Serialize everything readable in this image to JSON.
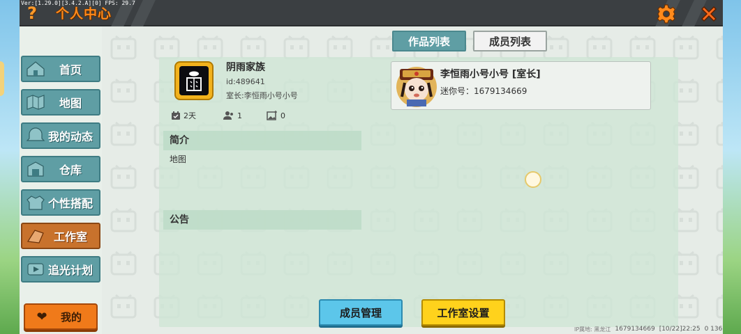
{
  "app": {
    "version": "Ver:[1.29.0][3.4.2.A][0] FPS: 29.7",
    "title": "个人中心"
  },
  "topbar": {
    "help_icon": "help-icon",
    "help_label": "?",
    "settings_icon": "gear-icon",
    "close_icon": "close-icon",
    "accent": "#ff8a1c"
  },
  "sidebar": {
    "items": [
      {
        "label": "首页",
        "icon": "home-icon"
      },
      {
        "label": "地图",
        "icon": "map-icon"
      },
      {
        "label": "我的动态",
        "icon": "feed-icon"
      },
      {
        "label": "仓库",
        "icon": "warehouse-icon"
      },
      {
        "label": "个性搭配",
        "icon": "outfit-icon"
      },
      {
        "label": "工作室",
        "icon": "studio-icon",
        "active": true
      },
      {
        "label": "追光计划",
        "icon": "spotlight-icon"
      }
    ],
    "mine_label": "我的",
    "mine_icon": "heart-icon"
  },
  "tabs": [
    {
      "label": "作品列表",
      "active": false
    },
    {
      "label": "成员列表",
      "active": true
    }
  ],
  "studio": {
    "name": "阴雨家族",
    "id": "id:489641",
    "owner": "室长:李恒雨小号小号",
    "stats": {
      "days": "2天",
      "members": "1",
      "works": "0"
    }
  },
  "sections": {
    "intro_title": "简介",
    "intro_text": "地图",
    "notice_title": "公告"
  },
  "members": [
    {
      "name": "李恒雨小号小号 [室长]",
      "mini": "迷你号：1679134669"
    }
  ],
  "buttons": {
    "manage_members": "成员管理",
    "studio_settings": "工作室设置"
  },
  "footer": {
    "ip": "IP属地: 黑龙江",
    "uid": "1679134669",
    "time": "[10/22]22:25",
    "extra": "0 136"
  },
  "colors": {
    "teal": "#5f9ea4",
    "orange": "#f07a1a",
    "blue_button": "#5cc6ea",
    "yellow_button": "#ffd21c",
    "topbar": "#3b3f42"
  }
}
